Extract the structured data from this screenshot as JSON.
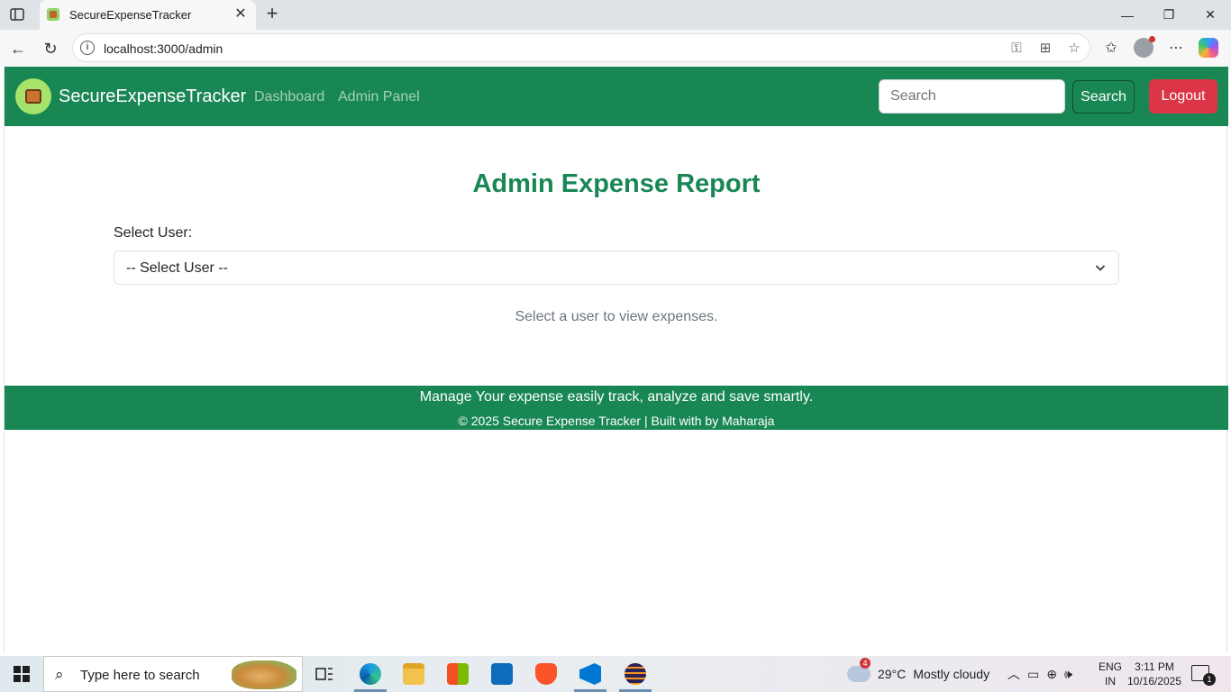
{
  "browser": {
    "tab_title": "SecureExpenseTracker",
    "url": "localhost:3000/admin"
  },
  "navbar": {
    "brand": "SecureExpenseTracker",
    "links": [
      "Dashboard",
      "Admin Panel"
    ],
    "search_placeholder": "Search",
    "search_button": "Search",
    "logout_button": "Logout",
    "colors": {
      "primary": "#198754",
      "danger": "#dc3545"
    }
  },
  "main": {
    "title": "Admin Expense Report",
    "select_label": "Select User:",
    "select_value": "-- Select User --",
    "empty_message": "Select a user to view expenses."
  },
  "footer": {
    "tagline": "Manage Your expense easily track, analyze and save smartly.",
    "copyright": "© 2025 Secure Expense Tracker | Built with by Maharaja"
  },
  "taskbar": {
    "search_text": "Type here to search",
    "weather_badge": "4",
    "temperature": "29°C",
    "weather": "Mostly cloudy",
    "lang_1": "ENG",
    "lang_2": "IN",
    "time": "3:11 PM",
    "date": "10/16/2025",
    "notification_count": "1"
  }
}
